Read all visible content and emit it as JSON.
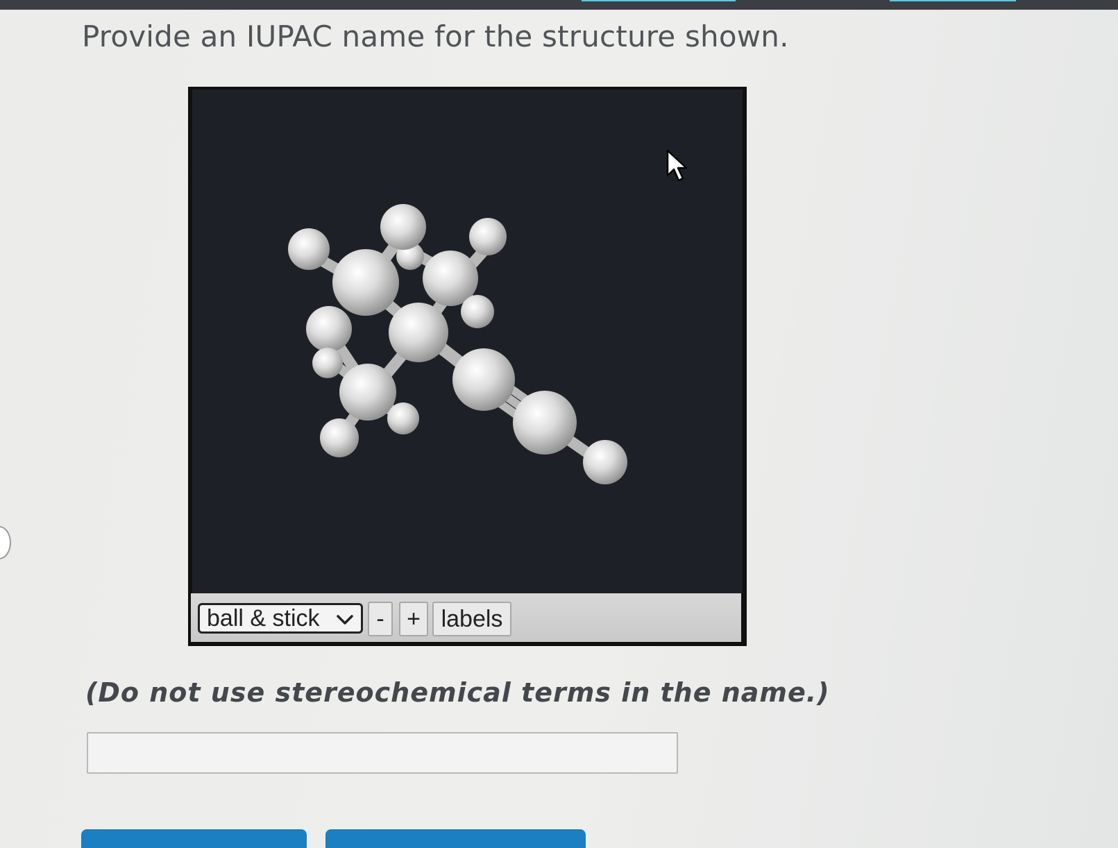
{
  "question": {
    "prompt": "Provide an IUPAC name for the structure shown.",
    "hint": "(Do not use stereochemical terms in the name.)"
  },
  "viewer": {
    "display_mode": "ball & stick",
    "zoom_out_label": "-",
    "zoom_in_label": "+",
    "labels_button": "labels"
  },
  "answer": {
    "value": "",
    "placeholder": ""
  },
  "colors": {
    "viewer_background": "#1d2127",
    "atom": "#d9d9d9",
    "button_blue": "#1b7fc2"
  }
}
